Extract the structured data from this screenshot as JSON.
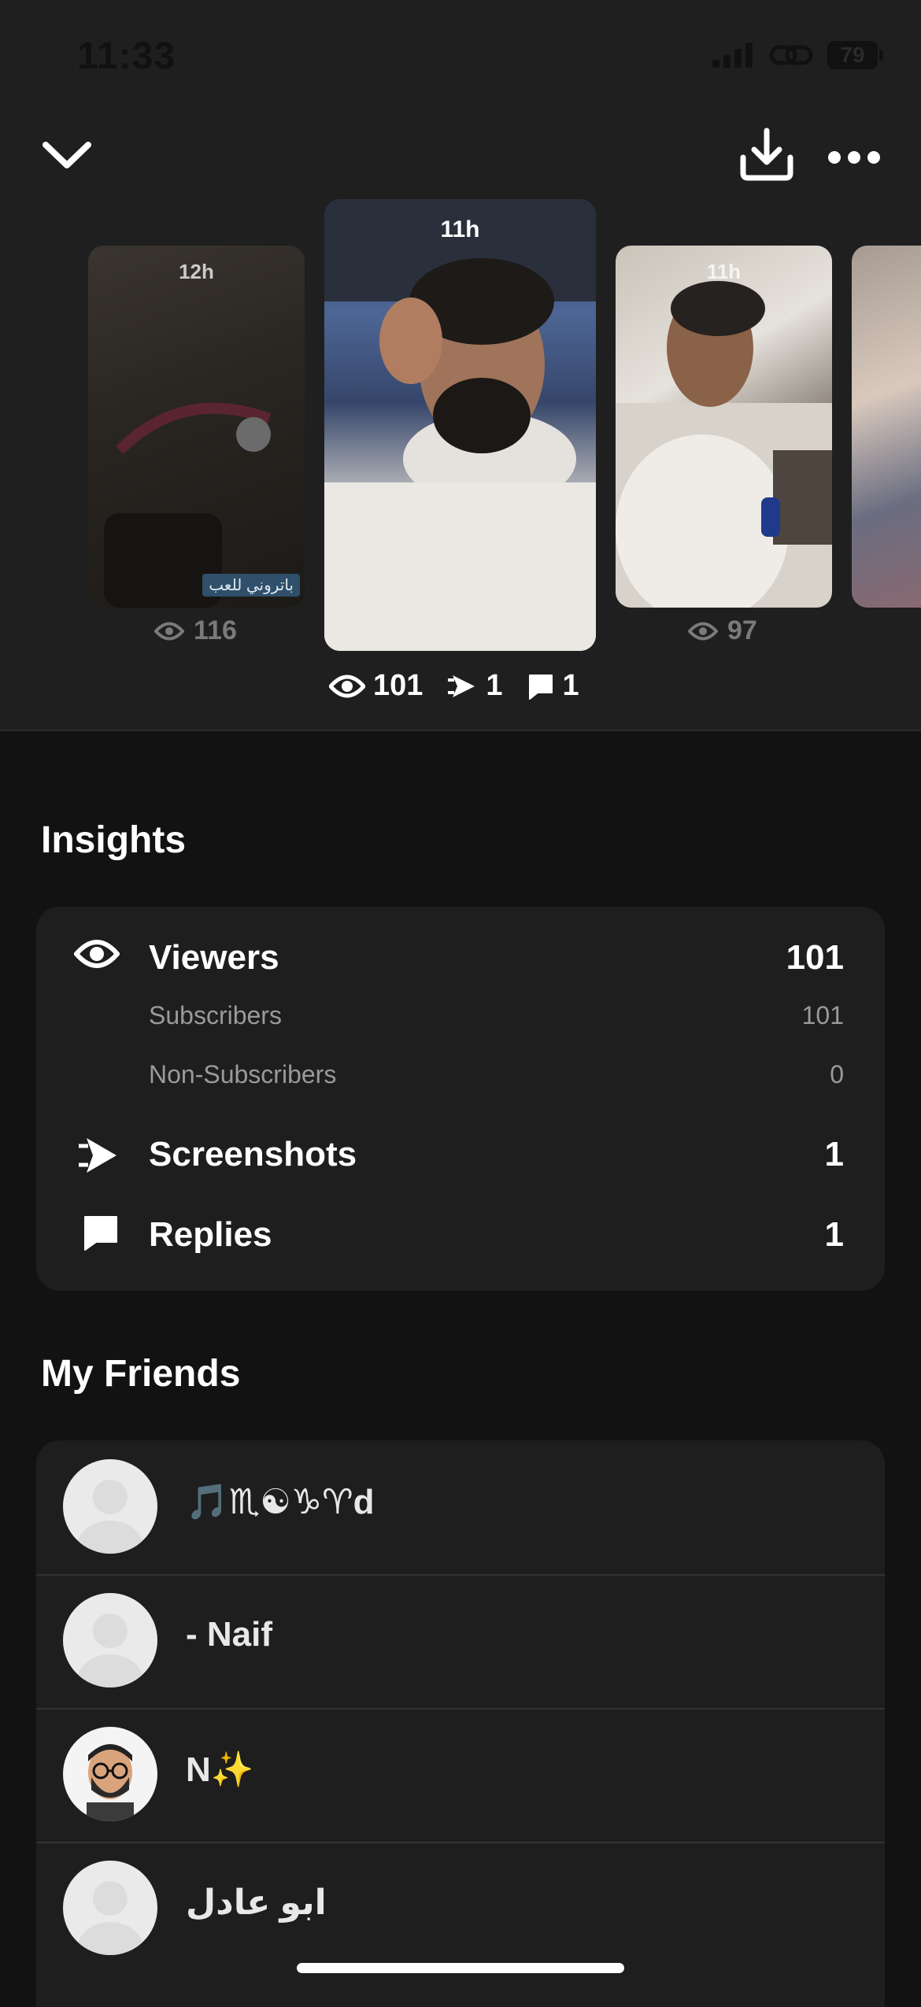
{
  "status_bar": {
    "time": "11:33",
    "battery": "79"
  },
  "snaps": [
    {
      "time": "12h",
      "views": "116"
    },
    {
      "time": "11h",
      "views": "101",
      "screenshots": "1",
      "replies": "1"
    },
    {
      "time": "11h",
      "views": "97"
    }
  ],
  "thumb1_caption": "باتروني للعب",
  "insights": {
    "title": "Insights",
    "viewers_label": "Viewers",
    "viewers_value": "101",
    "subscribers_label": "Subscribers",
    "subscribers_value": "101",
    "non_subscribers_label": "Non-Subscribers",
    "non_subscribers_value": "0",
    "screenshots_label": "Screenshots",
    "screenshots_value": "1",
    "replies_label": "Replies",
    "replies_value": "1"
  },
  "friends": {
    "title": "My Friends",
    "items": [
      {
        "name": "🎵♏☯♑♈d"
      },
      {
        "name": "- Naif"
      },
      {
        "name": "N✨"
      },
      {
        "name": "ابو عادل"
      }
    ]
  }
}
